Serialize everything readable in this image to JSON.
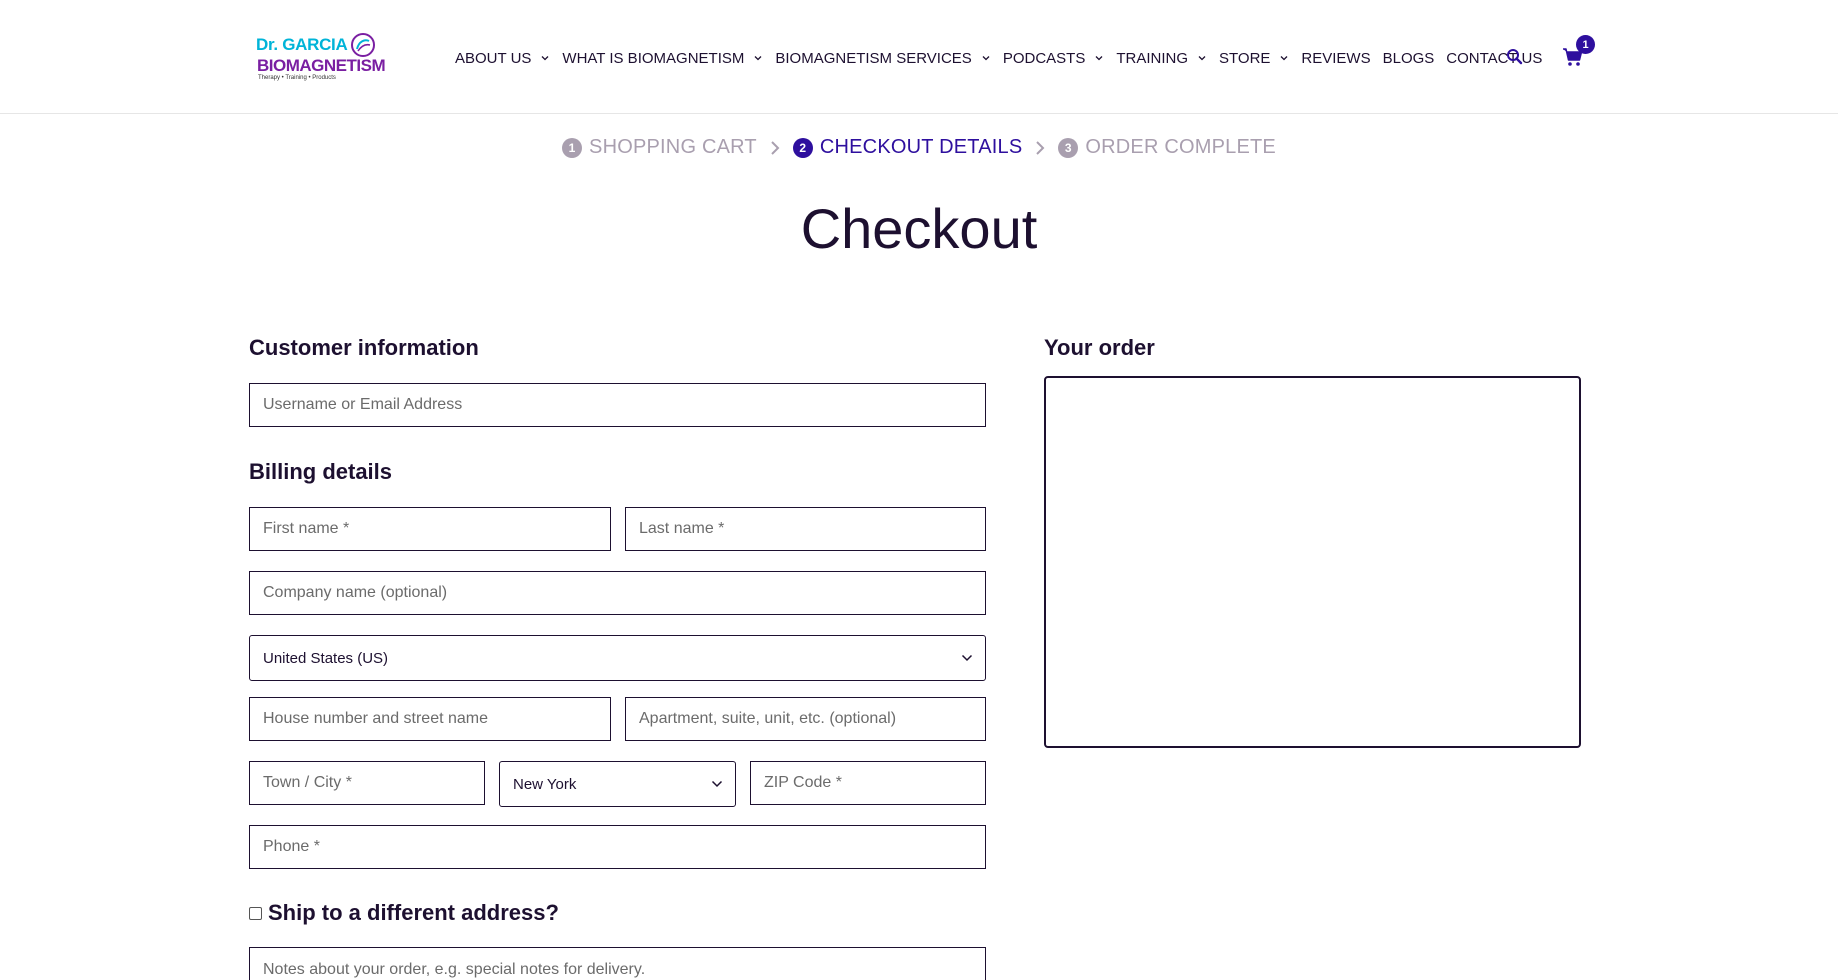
{
  "logo": {
    "line1_a": "Dr. ",
    "line1_b": "GARCIA",
    "line2": "BIOMAGNETISM",
    "line3": "Therapy • Training • Products"
  },
  "nav": {
    "items": [
      {
        "label": "ABOUT US",
        "has_dropdown": true
      },
      {
        "label": "WHAT IS BIOMAGNETISM",
        "has_dropdown": true
      },
      {
        "label": "BIOMAGNETISM SERVICES",
        "has_dropdown": true
      },
      {
        "label": "PODCASTS",
        "has_dropdown": true
      },
      {
        "label": "TRAINING",
        "has_dropdown": true
      },
      {
        "label": "STORE",
        "has_dropdown": true
      },
      {
        "label": "REVIEWS",
        "has_dropdown": false
      },
      {
        "label": "BLOGS",
        "has_dropdown": false
      },
      {
        "label": "CONTACT US",
        "has_dropdown": false
      }
    ],
    "search_icon": "search-icon",
    "cart_icon": "cart-icon",
    "cart_count": "1"
  },
  "steps": [
    {
      "num": "1",
      "label": "SHOPPING CART",
      "active": false
    },
    {
      "num": "2",
      "label": "CHECKOUT DETAILS",
      "active": true
    },
    {
      "num": "3",
      "label": "ORDER COMPLETE",
      "active": false
    }
  ],
  "page_title": "Checkout",
  "customer_info": {
    "heading": "Customer information",
    "username_placeholder": "Username or Email Address"
  },
  "billing": {
    "heading": "Billing details",
    "first_name_placeholder": "First name *",
    "last_name_placeholder": "Last name *",
    "company_placeholder": "Company name (optional)",
    "country_value": "United States (US)",
    "street_placeholder": "House number and street name",
    "apartment_placeholder": "Apartment, suite, unit, etc. (optional)",
    "city_placeholder": "Town / City *",
    "state_value": "New York",
    "zip_placeholder": "ZIP Code *",
    "phone_placeholder": "Phone *"
  },
  "shipping": {
    "ship_label": "Ship to a different address?",
    "ship_checked": false,
    "notes_placeholder": "Notes about your order, e.g. special notes for delivery."
  },
  "order": {
    "heading": "Your order"
  },
  "colors": {
    "accent": "#2e0f9e",
    "text": "#1d1030",
    "muted": "#a99faf"
  }
}
